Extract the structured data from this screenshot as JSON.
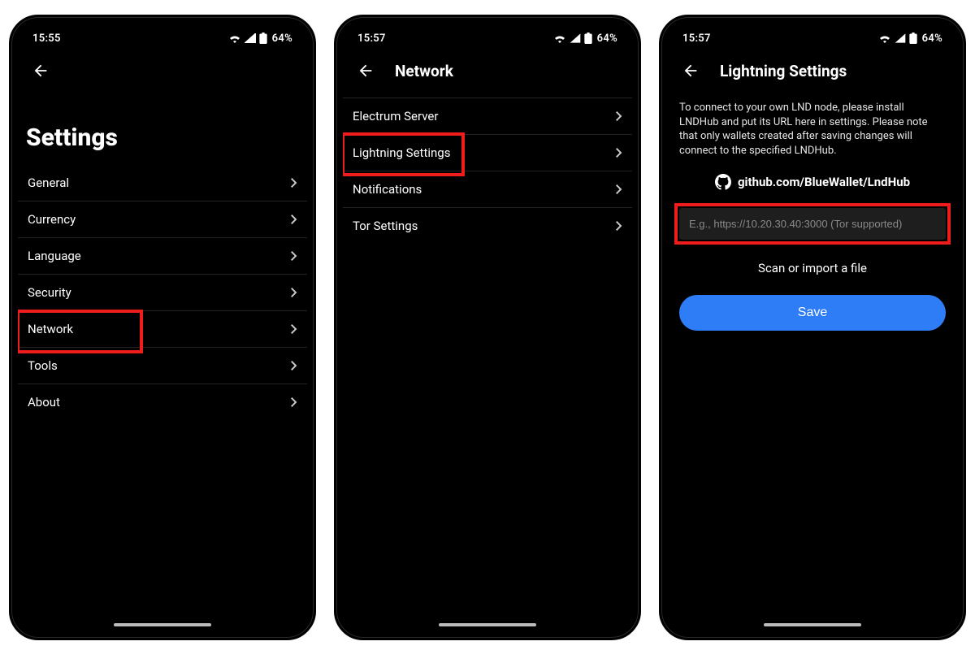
{
  "status": {
    "time_a": "15:55",
    "time_b": "15:57",
    "time_c": "15:57",
    "battery": "64%"
  },
  "screen1": {
    "title": "Settings",
    "items": [
      {
        "label": "General"
      },
      {
        "label": "Currency"
      },
      {
        "label": "Language"
      },
      {
        "label": "Security"
      },
      {
        "label": "Network",
        "highlight": true
      },
      {
        "label": "Tools"
      },
      {
        "label": "About"
      }
    ]
  },
  "screen2": {
    "title": "Network",
    "items": [
      {
        "label": "Electrum Server"
      },
      {
        "label": "Lightning Settings",
        "highlight": true
      },
      {
        "label": "Notifications"
      },
      {
        "label": "Tor Settings"
      }
    ]
  },
  "screen3": {
    "title": "Lightning Settings",
    "description": "To connect to your own LND node, please install LNDHub and put its URL here in settings. Please note that only wallets created after saving changes will connect to the specified LNDHub.",
    "repo": "github.com/BlueWallet/LndHub",
    "url_placeholder": "E.g., https://10.20.30.40:3000 (Tor supported)",
    "scan_label": "Scan or import a file",
    "save_label": "Save"
  },
  "highlight_color": "#ef1c1c",
  "accent_color": "#2f7df6"
}
